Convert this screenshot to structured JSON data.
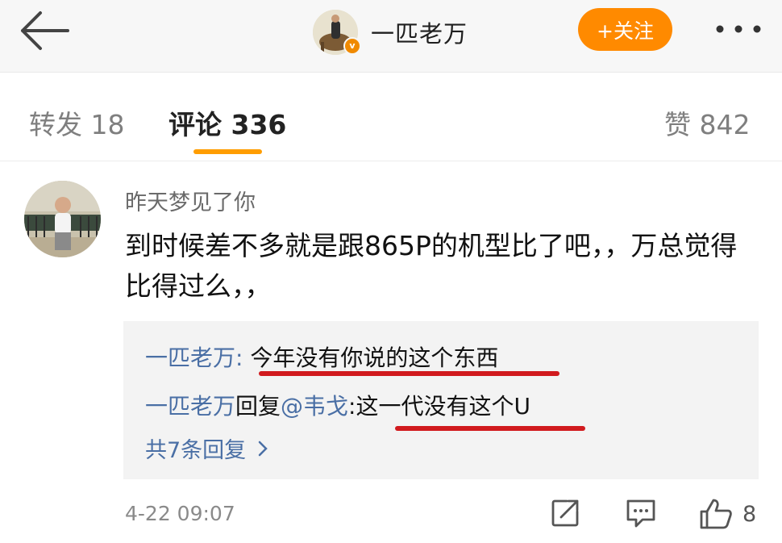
{
  "header": {
    "username": "一匹老万",
    "verified_badge": "v",
    "follow_label": "+关注",
    "icons": [
      "back-arrow-icon",
      "more-dots-icon"
    ]
  },
  "tabs": [
    {
      "label": "转发 18",
      "active": false
    },
    {
      "label": "评论 336",
      "active": true
    },
    {
      "label": "赞 842",
      "active": false
    }
  ],
  "comment": {
    "author": "昨天梦见了你",
    "text": "到时候差不多就是跟865P的机型比了吧，，万总觉得比得过么，，",
    "replies": [
      {
        "author": "一匹老万",
        "separator": ": ",
        "text": "今年没有你说的这个东西"
      },
      {
        "author": "一匹老万",
        "mid": "回复",
        "mention": "@韦戈",
        "separator": ":",
        "text": "这一代没有这个U"
      }
    ],
    "view_all_label": "共7条回复",
    "time": "4-22 09:07",
    "like_count": "8"
  },
  "colors": {
    "accent_orange": "#ff8a00",
    "link_blue": "#4a6fa5",
    "annotation_red": "#d11a1e"
  }
}
